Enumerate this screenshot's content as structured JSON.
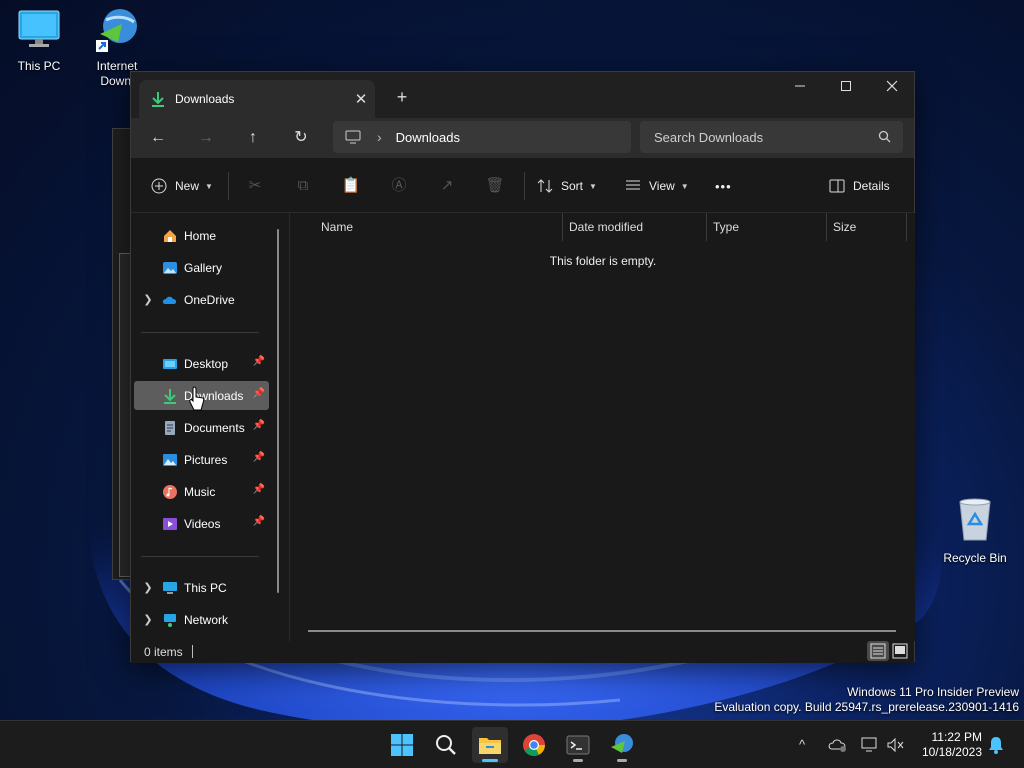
{
  "desktop": {
    "icons": [
      {
        "label": "This PC"
      },
      {
        "label": "Internet\nDownl"
      },
      {
        "label": "Recycle Bin"
      }
    ],
    "watermark": {
      "line1": "Windows 11 Pro Insider Preview",
      "line2": "Evaluation copy. Build 25947.rs_prerelease.230901-1416"
    }
  },
  "explorer": {
    "tab_title": "Downloads",
    "tab_close": "✕",
    "new_tab": "+",
    "window_controls": {
      "minimize": "—",
      "maximize": "☐",
      "close": "✕"
    },
    "nav": {
      "back": "←",
      "forward": "→",
      "up": "↑",
      "refresh": "↻"
    },
    "breadcrumb": {
      "separator": "›",
      "current": "Downloads"
    },
    "search_placeholder": "Search Downloads",
    "commands": {
      "new_label": "New",
      "sort_label": "Sort",
      "view_label": "View",
      "more_label": "•••",
      "details_label": "Details"
    },
    "sidebar": {
      "items": [
        {
          "label": "Home",
          "icon": "home-icon"
        },
        {
          "label": "Gallery",
          "icon": "gallery-icon"
        },
        {
          "label": "OneDrive",
          "icon": "cloud-icon",
          "expandable": true
        },
        {
          "label": "Desktop",
          "icon": "desktop-folder-icon",
          "pinned": true
        },
        {
          "label": "Downloads",
          "icon": "download-icon",
          "pinned": true,
          "selected": true
        },
        {
          "label": "Documents",
          "icon": "documents-icon",
          "pinned": true
        },
        {
          "label": "Pictures",
          "icon": "pictures-icon",
          "pinned": true
        },
        {
          "label": "Music",
          "icon": "music-icon",
          "pinned": true
        },
        {
          "label": "Videos",
          "icon": "videos-icon",
          "pinned": true
        },
        {
          "label": "This PC",
          "icon": "computer-icon",
          "expandable": true
        },
        {
          "label": "Network",
          "icon": "network-icon",
          "expandable": true
        }
      ]
    },
    "columns": [
      "Name",
      "Date modified",
      "Type",
      "Size"
    ],
    "empty_message": "This folder is empty.",
    "status": {
      "item_count": "0 items"
    }
  },
  "taskbar": {
    "clock_time": "11:22 PM",
    "clock_date": "10/18/2023",
    "tray_overflow": "^"
  },
  "colors": {
    "accent": "#4cc2ff",
    "window_bg": "#191919",
    "selected_item": "#5d5d5d",
    "download_green": "#3ec97b"
  }
}
